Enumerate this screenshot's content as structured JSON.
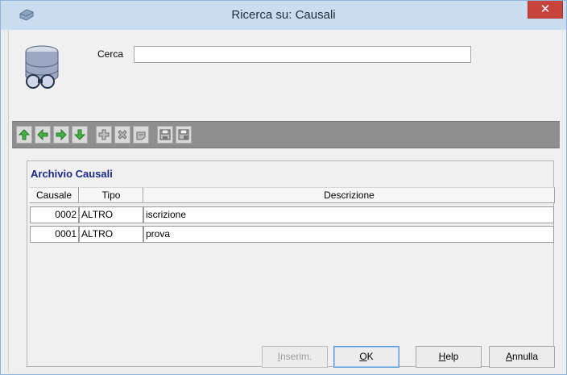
{
  "window": {
    "title": "Ricerca su:  Causali",
    "close_glyph": "✕",
    "icon": "window-app-icon"
  },
  "search": {
    "label": "Cerca",
    "value": "",
    "placeholder": ""
  },
  "toolbar": {
    "buttons": [
      {
        "name": "first",
        "icon": "arrow-up-icon"
      },
      {
        "name": "previous",
        "icon": "arrow-left-icon"
      },
      {
        "name": "next",
        "icon": "arrow-right-icon"
      },
      {
        "name": "last",
        "icon": "arrow-down-icon"
      },
      {
        "name": "add",
        "icon": "plus-icon"
      },
      {
        "name": "delete",
        "icon": "x-icon"
      },
      {
        "name": "undo",
        "icon": "undo-icon"
      },
      {
        "name": "save",
        "icon": "save-icon"
      },
      {
        "name": "save-all",
        "icon": "save-all-icon"
      }
    ],
    "bg_color": "#8e8e8e"
  },
  "archive": {
    "title": "Archivio Causali",
    "columns": [
      "Causale",
      "Tipo",
      "Descrizione"
    ],
    "rows": [
      {
        "causale": "0002",
        "tipo": "ALTRO",
        "descrizione": "iscrizione"
      },
      {
        "causale": "0001",
        "tipo": "ALTRO",
        "descrizione": "prova"
      }
    ]
  },
  "buttons": {
    "insert": {
      "label_pre": "",
      "label_u": "I",
      "label_post": "nserim.",
      "enabled": false
    },
    "ok": {
      "label_pre": "",
      "label_u": "O",
      "label_post": "K",
      "default": true
    },
    "help": {
      "label_pre": "",
      "label_u": "H",
      "label_post": "elp"
    },
    "cancel": {
      "label_pre": "",
      "label_u": "A",
      "label_post": "nnulla"
    }
  },
  "colors": {
    "title_text": "#1e2d3c",
    "close_bg": "#c7443d",
    "panel_title": "#1a2a8c",
    "toolbar_green": "#3aa63a"
  }
}
